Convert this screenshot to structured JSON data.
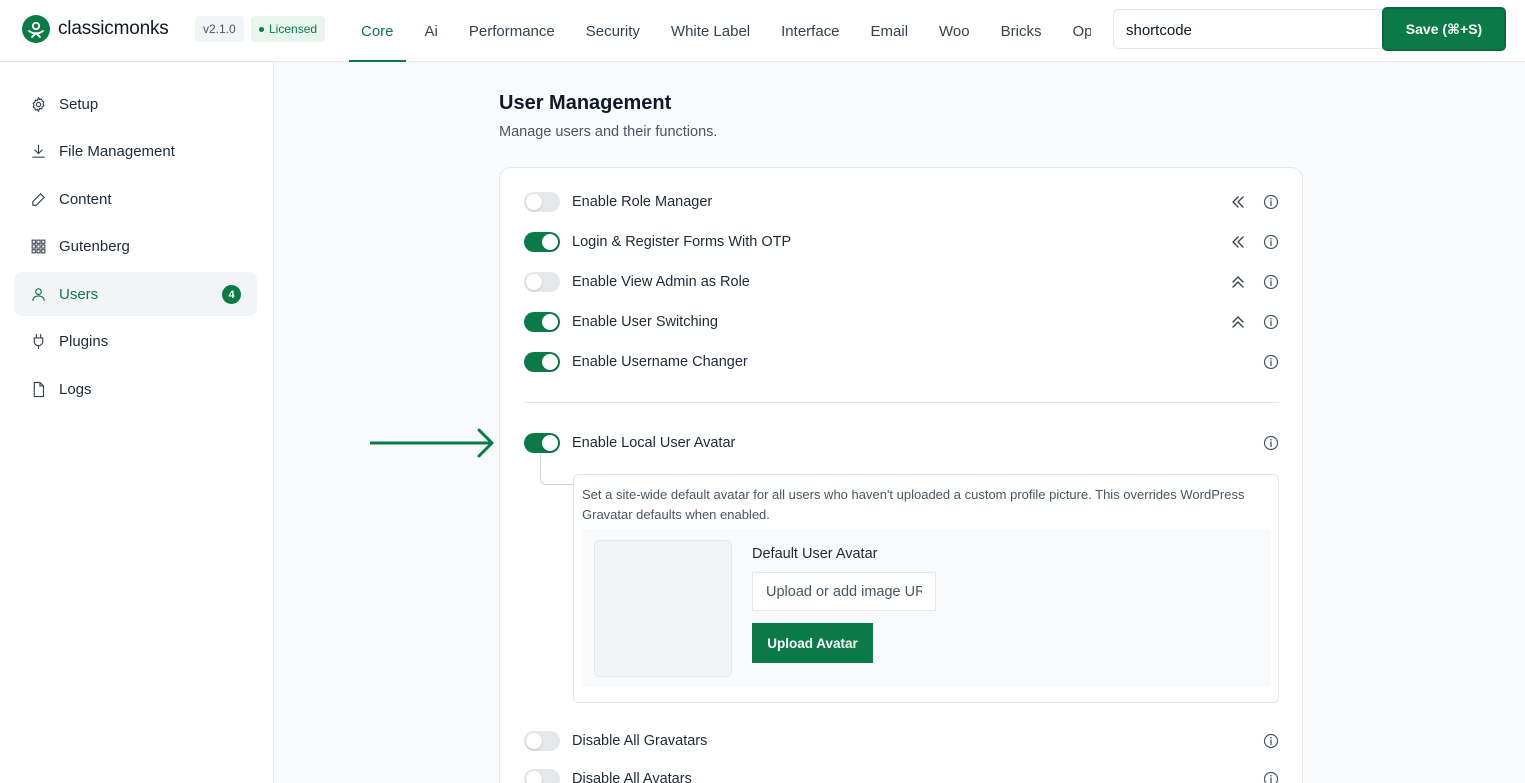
{
  "brand": {
    "name": "classicmonks",
    "version": "v2.1.0",
    "license": "Licensed",
    "accent": "#0b7a46"
  },
  "nav": {
    "tabs": [
      {
        "label": "Core",
        "active": true
      },
      {
        "label": "Ai"
      },
      {
        "label": "Performance"
      },
      {
        "label": "Security"
      },
      {
        "label": "White Label"
      },
      {
        "label": "Interface"
      },
      {
        "label": "Email"
      },
      {
        "label": "Woo"
      },
      {
        "label": "Bricks"
      },
      {
        "label": "Options"
      }
    ]
  },
  "search": {
    "value": "shortcode",
    "clear_icon": "close-icon"
  },
  "toolbar": {
    "save_label": "Save (⌘+S)"
  },
  "sidebar": {
    "items": [
      {
        "label": "Setup",
        "icon": "gear-icon"
      },
      {
        "label": "File Management",
        "icon": "download-icon"
      },
      {
        "label": "Content",
        "icon": "edit-icon"
      },
      {
        "label": "Gutenberg",
        "icon": "grid-icon"
      },
      {
        "label": "Users",
        "icon": "user-icon",
        "active": true,
        "count": "4"
      },
      {
        "label": "Plugins",
        "icon": "plug-icon"
      },
      {
        "label": "Logs",
        "icon": "file-icon"
      }
    ]
  },
  "main": {
    "title": "User Management",
    "subtitle": "Manage users and their functions.",
    "settings": [
      {
        "label": "Enable Role Manager",
        "enabled": false,
        "chevron": "chevrons-left-icon"
      },
      {
        "label": "Login & Register Forms With OTP",
        "enabled": true,
        "chevron": "chevrons-left-icon"
      },
      {
        "label": "Enable View Admin as Role",
        "enabled": false,
        "chevron": "chevrons-up-icon"
      },
      {
        "label": "Enable User Switching",
        "enabled": true,
        "chevron": "chevrons-up-icon"
      },
      {
        "label": "Enable Username Changer",
        "enabled": true
      },
      {
        "label": "Enable Local User Avatar",
        "enabled": true
      },
      {
        "label": "Disable All Gravatars",
        "enabled": false
      },
      {
        "label": "Disable All Avatars",
        "enabled": false
      }
    ],
    "avatar_panel": {
      "description": "Set a site-wide default avatar for all users who haven't uploaded a custom profile picture. This overrides WordPress Gravatar defaults when enabled.",
      "field_label": "Default User Avatar",
      "input_placeholder": "Upload or add image URL",
      "upload_label": "Upload Avatar"
    }
  }
}
